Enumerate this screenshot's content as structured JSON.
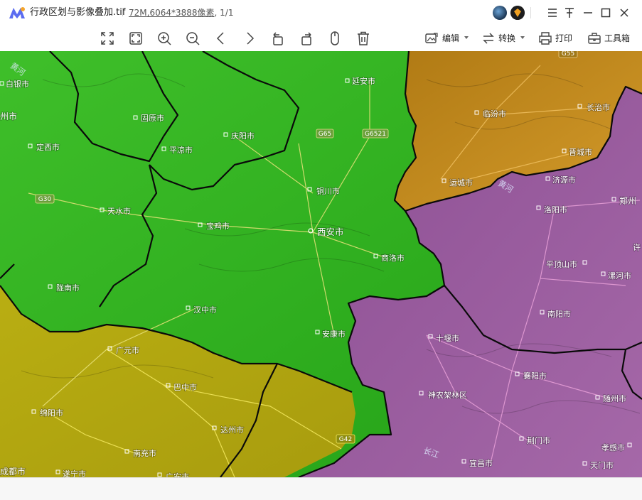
{
  "window": {
    "title": "行政区划与影像叠加.tif",
    "file_size": "72M",
    "dimensions": ",6064*3888像素",
    "page_info": ", 1/1"
  },
  "titlebar_icons": [
    "app-logo-icon",
    "user-avatar-icon",
    "badge-icon",
    "menu-icon",
    "pin-icon",
    "minimize-icon",
    "maximize-icon",
    "close-icon"
  ],
  "toolbar": {
    "edit_label": "编辑",
    "convert_label": "转换",
    "print_label": "打印",
    "toolbox_label": "工具箱",
    "icons": [
      "fit-screen-icon",
      "actual-size-icon",
      "zoom-in-icon",
      "zoom-out-icon",
      "previous-icon",
      "next-icon",
      "rotate-left-icon",
      "rotate-right-icon",
      "mouse-icon",
      "delete-icon"
    ]
  },
  "map": {
    "city_labels": [
      {
        "name": "white-silver",
        "text": "白银市"
      },
      {
        "name": "guyuan",
        "text": "固原市"
      },
      {
        "name": "yanan",
        "text": "延安市"
      },
      {
        "name": "linfen",
        "text": "临汾市"
      },
      {
        "name": "changzhi",
        "text": "长治市"
      },
      {
        "name": "qingyang",
        "text": "庆阳市"
      },
      {
        "name": "dingxi",
        "text": "定西市"
      },
      {
        "name": "pingliang",
        "text": "平凉市"
      },
      {
        "name": "jincheng",
        "text": "晋城市"
      },
      {
        "name": "yuncheng",
        "text": "运城市"
      },
      {
        "name": "jiyuan",
        "text": "济源市"
      },
      {
        "name": "tongchuan",
        "text": "铜川市"
      },
      {
        "name": "tianshui",
        "text": "天水市"
      },
      {
        "name": "luoyang",
        "text": "洛阳市"
      },
      {
        "name": "zhengzhou",
        "text": "郑州"
      },
      {
        "name": "baoji",
        "text": "宝鸡市"
      },
      {
        "name": "xian",
        "text": "西安市"
      },
      {
        "name": "shangluo",
        "text": "商洛市"
      },
      {
        "name": "pingdingshan",
        "text": "平顶山市"
      },
      {
        "name": "luohe",
        "text": "漯河市"
      },
      {
        "name": "longnan",
        "text": "陇南市"
      },
      {
        "name": "hanzhong",
        "text": "汉中市"
      },
      {
        "name": "nanyang",
        "text": "南阳市"
      },
      {
        "name": "ankang",
        "text": "安康市"
      },
      {
        "name": "shiyan",
        "text": "十堰市"
      },
      {
        "name": "guangyuan",
        "text": "广元市"
      },
      {
        "name": "xiangyang",
        "text": "襄阳市"
      },
      {
        "name": "bazhong",
        "text": "巴中市"
      },
      {
        "name": "shennongjia",
        "text": "神农架林区"
      },
      {
        "name": "suizhou",
        "text": "随州市"
      },
      {
        "name": "mianyang",
        "text": "绵阳市"
      },
      {
        "name": "dazhou",
        "text": "达州市"
      },
      {
        "name": "jingmen",
        "text": "荆门市"
      },
      {
        "name": "xiaogan",
        "text": "孝感市"
      },
      {
        "name": "nanchong",
        "text": "南充市"
      },
      {
        "name": "yichang",
        "text": "宜昌市"
      },
      {
        "name": "tianmen",
        "text": "天门市"
      },
      {
        "name": "chengdu",
        "text": "成都市"
      },
      {
        "name": "suining",
        "text": "遂宁市"
      },
      {
        "name": "guangan",
        "text": "广安市"
      }
    ],
    "highway_labels": [
      "G65",
      "G6521",
      "G30",
      "G55",
      "G42"
    ],
    "river_labels": [
      "黄河",
      "长江",
      "黄河"
    ],
    "edge_labels": [
      "州市",
      "许"
    ],
    "colors": {
      "green_region": "#2ea81d",
      "orange_region": "#c98a1c",
      "purple_region": "#9a5aa0",
      "yellow_region": "#b9ad13",
      "boundary": "#0a0a0a"
    }
  }
}
